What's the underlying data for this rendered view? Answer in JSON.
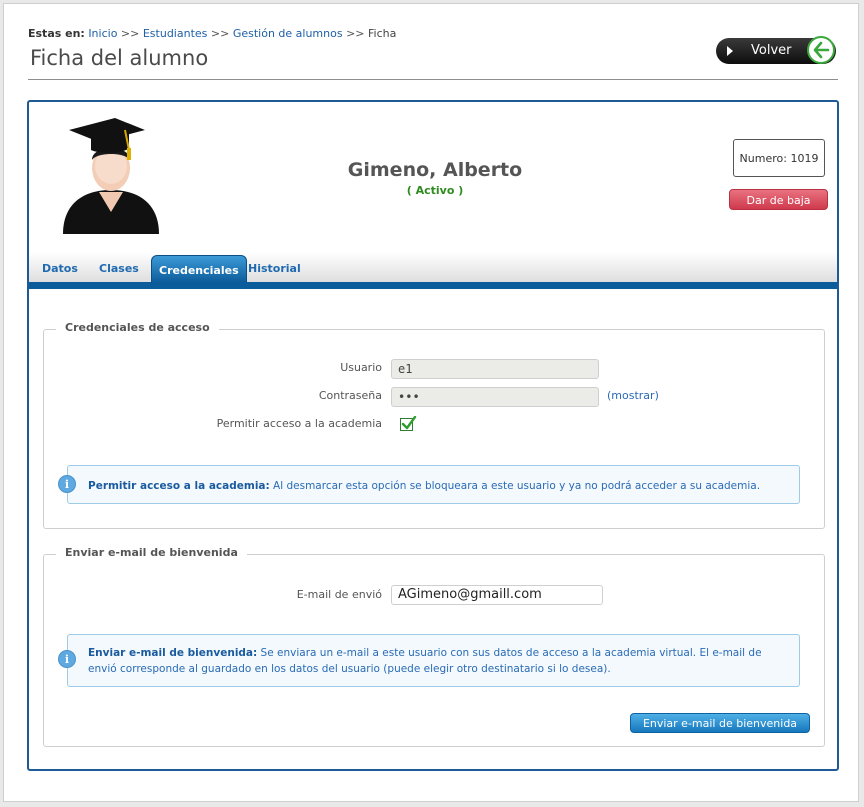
{
  "breadcrumb": {
    "lead": "Estas en:",
    "items": [
      "Inicio",
      "Estudiantes",
      "Gestión de alumnos",
      "Ficha"
    ],
    "separator": ">>"
  },
  "page_title": "Ficha del alumno",
  "back_button": {
    "label": "Volver"
  },
  "student": {
    "name": "Gimeno, Alberto",
    "status": "( Activo )",
    "numero": "Numero: 1019"
  },
  "baja_button": "Dar de baja",
  "tabs": [
    {
      "label": "Datos",
      "active": false
    },
    {
      "label": "Clases",
      "active": false
    },
    {
      "label": "Credenciales",
      "active": true
    },
    {
      "label": "Historial",
      "active": false
    }
  ],
  "credenciales": {
    "legend": "Credenciales de acceso",
    "usuario_label": "Usuario",
    "usuario_value": "e1",
    "contrasena_label": "Contraseña",
    "contrasena_value": "•••",
    "mostrar_link": "(mostrar)",
    "permitir_label": "Permitir acceso a la academia",
    "permitir_checked": true,
    "info_title": "Permitir acceso a la academia:",
    "info_text": " Al desmarcar esta opción se bloqueara a este usuario y ya no podrá acceder a su academia."
  },
  "bienvenida": {
    "legend": "Enviar e-mail de bienvenida",
    "email_label": "E-mail de envió",
    "email_value": "AGimeno@gmaill.com",
    "info_title": "Enviar e-mail de bienvenida:",
    "info_text": " Se enviara un e-mail a este usuario con sus datos de acceso a la academia virtual. El e-mail de envió corresponde al guardado en los datos del usuario (puede elegir otro destinatario si lo desea).",
    "send_button": "Enviar e-mail de bienvenida"
  },
  "colors": {
    "accent": "#0a5c9a",
    "status_active": "#2e8b1f",
    "danger": "#cf3a4d",
    "link": "#1f5fa8"
  },
  "icons": [
    "play-arrow-icon",
    "back-arrow-icon",
    "student-avatar-icon",
    "checkmark-icon",
    "info-icon"
  ]
}
